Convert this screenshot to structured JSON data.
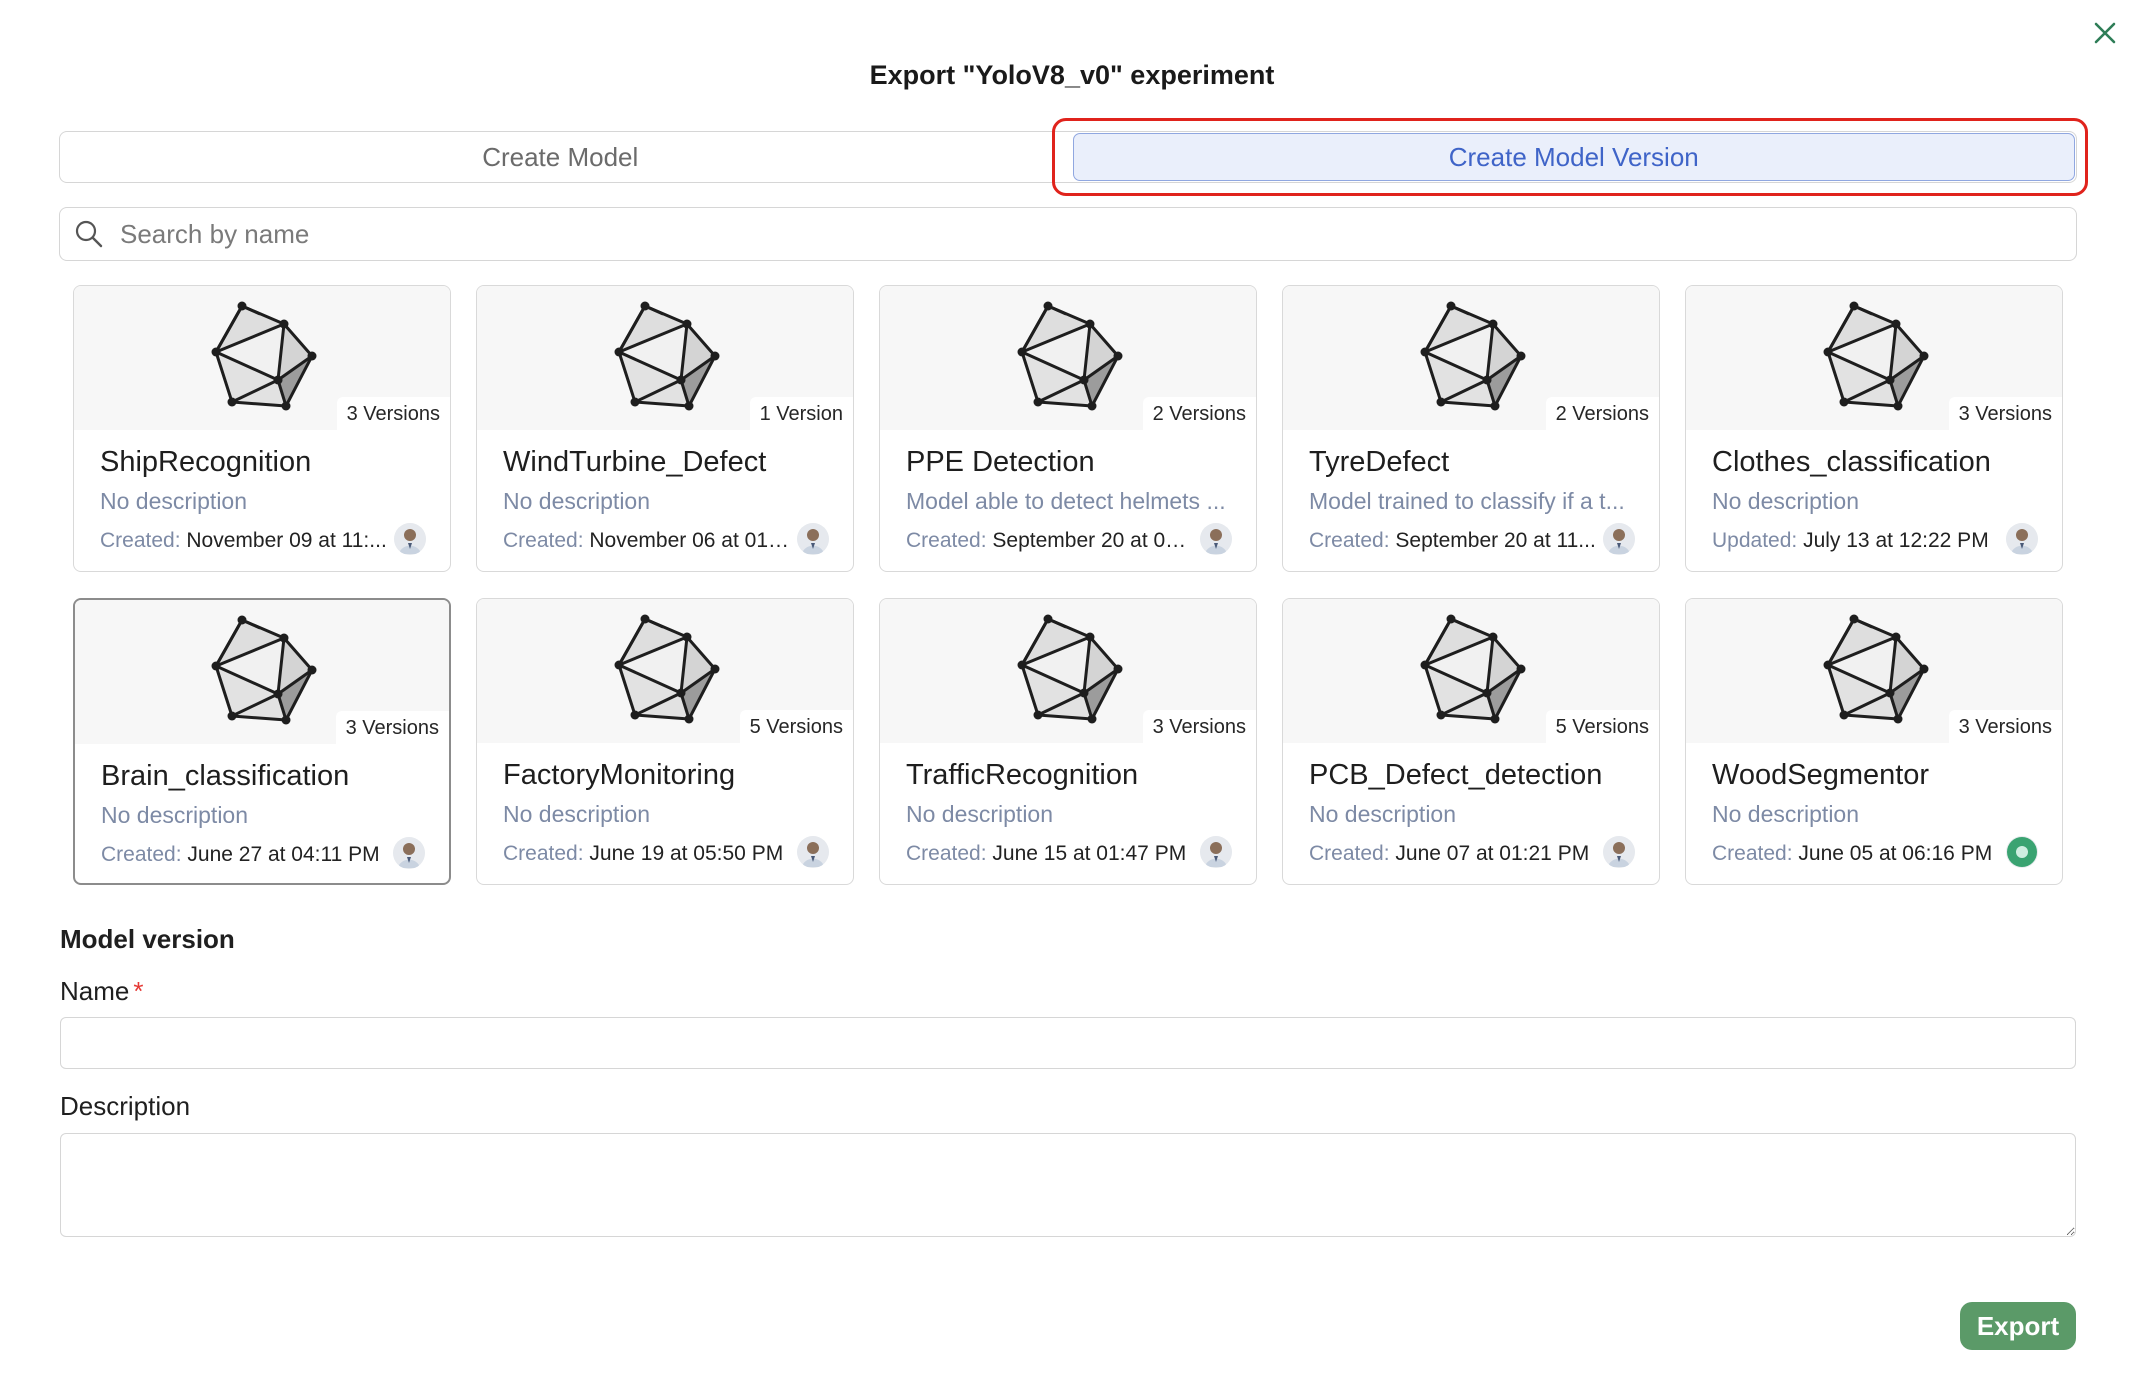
{
  "dialog": {
    "title": "Export \"YoloV8_v0\" experiment",
    "tabs": [
      {
        "label": "Create Model",
        "active": false
      },
      {
        "label": "Create Model Version",
        "active": true
      }
    ],
    "search": {
      "placeholder": "Search by name",
      "value": ""
    },
    "accent_color": "#3f64c8",
    "highlight_color": "#e0231c"
  },
  "models": [
    {
      "name": "ShipRecognition",
      "versions": "3 Versions",
      "description": "No description",
      "date_prefix": "Created:",
      "date": "November 09 at 11:...",
      "avatar": "user-photo"
    },
    {
      "name": "WindTurbine_Defect",
      "versions": "1 Version",
      "description": "No description",
      "date_prefix": "Created:",
      "date": "November 06 at 01:...",
      "avatar": "user-photo"
    },
    {
      "name": "PPE Detection",
      "versions": "2 Versions",
      "description": "Model able to detect helmets ...",
      "date_prefix": "Created:",
      "date": "September 20 at 02...",
      "avatar": "user-photo"
    },
    {
      "name": "TyreDefect",
      "versions": "2 Versions",
      "description": "Model trained to classify if a t...",
      "date_prefix": "Created:",
      "date": "September 20 at 11...",
      "avatar": "user-photo"
    },
    {
      "name": "Clothes_classification",
      "versions": "3 Versions",
      "description": "No description",
      "date_prefix": "Updated:",
      "date": "July 13 at 12:22 PM",
      "avatar": "user-photo"
    },
    {
      "name": "Brain_classification",
      "versions": "3 Versions",
      "description": "No description",
      "date_prefix": "Created:",
      "date": "June 27 at 04:11 PM",
      "avatar": "user-photo",
      "selected": true
    },
    {
      "name": "FactoryMonitoring",
      "versions": "5 Versions",
      "description": "No description",
      "date_prefix": "Created:",
      "date": "June 19 at 05:50 PM",
      "avatar": "user-photo"
    },
    {
      "name": "TrafficRecognition",
      "versions": "3 Versions",
      "description": "No description",
      "date_prefix": "Created:",
      "date": "June 15 at 01:47 PM",
      "avatar": "user-photo"
    },
    {
      "name": "PCB_Defect_detection",
      "versions": "5 Versions",
      "description": "No description",
      "date_prefix": "Created:",
      "date": "June 07 at 01:21 PM",
      "avatar": "user-photo"
    },
    {
      "name": "WoodSegmentor",
      "versions": "3 Versions",
      "description": "No description",
      "date_prefix": "Created:",
      "date": "June 05 at 06:16 PM",
      "avatar": "green-avatar"
    }
  ],
  "form": {
    "section_title": "Model version",
    "name_label": "Name",
    "required_mark": "*",
    "name_value": "",
    "description_label": "Description",
    "description_value": "",
    "export_label": "Export",
    "export_color": "#5b9a68"
  }
}
